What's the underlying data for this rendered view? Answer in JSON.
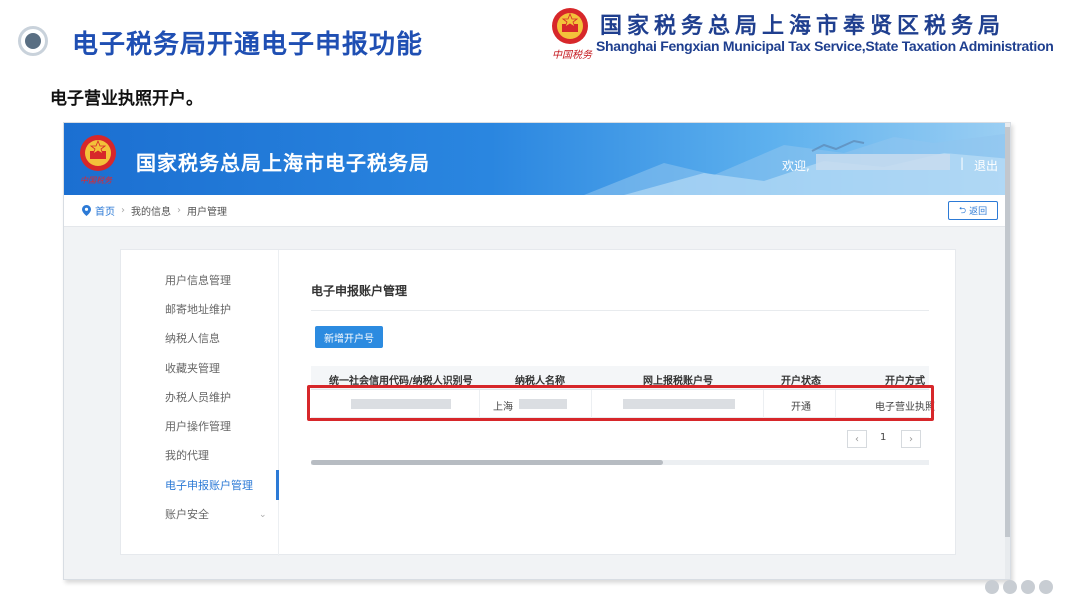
{
  "slide": {
    "title": "电子税务局开通电子申报功能",
    "subtitle": "电子营业执照开户。",
    "org_name_cn": "国家税务总局上海市奉贤区税务局",
    "org_name_en": "Shanghai Fengxian Municipal Tax Service,State Taxation Administration",
    "seal_text": "中国税务"
  },
  "app": {
    "banner_title": "国家税务总局上海市电子税务局",
    "banner_seal": "中国税务",
    "welcome_label": "欢迎,",
    "separator": "|",
    "logout_label": "退出",
    "back_label": "返回",
    "breadcrumb": [
      "首页",
      "我的信息",
      "用户管理"
    ],
    "sidebar": {
      "items": [
        {
          "label": "用户信息管理"
        },
        {
          "label": "邮寄地址维护"
        },
        {
          "label": "纳税人信息"
        },
        {
          "label": "收藏夹管理"
        },
        {
          "label": "办税人员维护"
        },
        {
          "label": "用户操作管理"
        },
        {
          "label": "我的代理"
        },
        {
          "label": "电子申报账户管理"
        },
        {
          "label": "账户安全"
        }
      ],
      "active_index": 7
    },
    "panel": {
      "title": "电子申报账户管理",
      "add_button": "新增开户号"
    },
    "table": {
      "headers": [
        "统一社会信用代码/纳税人识别号",
        "纳税人名称",
        "网上报税账户号",
        "开户状态",
        "开户方式"
      ],
      "rows": [
        {
          "name": "上海",
          "status": "开通",
          "method": "电子营业执照"
        }
      ]
    },
    "pager": {
      "prev": "‹",
      "page": "1",
      "next": "›"
    }
  },
  "colors": {
    "accent": "#2c7ad6",
    "highlight": "#d7272a",
    "title": "#1f4fb3"
  }
}
